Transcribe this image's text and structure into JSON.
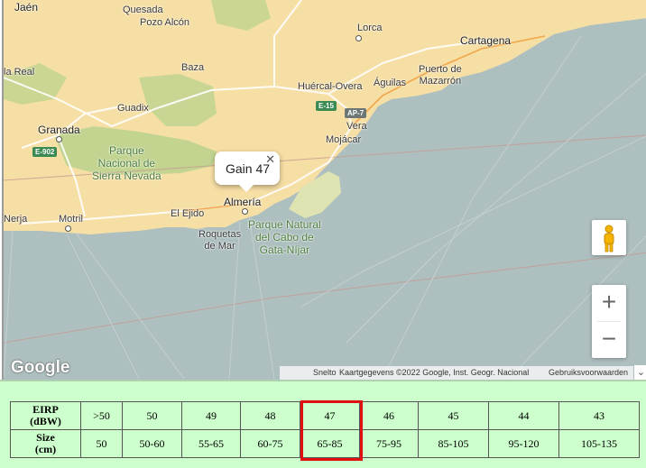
{
  "map": {
    "places": {
      "jaen": "Jaén",
      "quesada": "Quesada",
      "pozo_alcon": "Pozo Alcón",
      "lorca": "Lorca",
      "cartagena": "Cartagena",
      "la_real": "la Real",
      "baza": "Baza",
      "puerto_de_mazarron": "Puerto de\nMazarrón",
      "huercal_overa": "Huércal-Overa",
      "aguilas": "Águilas",
      "guadix": "Guadix",
      "vera": "Vera",
      "granada": "Granada",
      "mojacar": "Mojácar",
      "almeria": "Almería",
      "el_ejido": "El Ejido",
      "nerja": "Nerja",
      "motril": "Motril",
      "roquetas": "Roquetas\nde Mar",
      "park_sierra": "Parque\nNacional de\nSierra Nevada",
      "park_cabo": "Parque Natural\ndel Cabo de\nGata-Níjar"
    },
    "roads": {
      "e15": "E-15",
      "ap7": "AP-7",
      "e902": "E-902"
    },
    "popup": {
      "text": "Gain 47",
      "close": "✕"
    },
    "zoom_in": "+",
    "zoom_out": "−",
    "logo": "Google",
    "attribution": {
      "shortcuts": "Snelto",
      "data": "Kaartgegevens ©2022 Google, Inst. Geogr. Nacional",
      "terms": "Gebruiksvoorwaarden"
    },
    "chevron": "⌄",
    "icons": [
      "pegman-icon",
      "close-icon",
      "zoom-in-icon",
      "zoom-out-icon"
    ],
    "colors": {
      "land": "#f6dfa5",
      "sea": "#aebfc0",
      "park": "#b9d28c",
      "highlight": "#e01010",
      "table_bg": "#ccffcc"
    }
  },
  "table": {
    "eirp_header": "EIRP\n(dBW)",
    "size_header": "Size\n(cm)",
    "eirp": [
      ">50",
      "50",
      "49",
      "48",
      "47",
      "46",
      "45",
      "44",
      "43"
    ],
    "size": [
      "50",
      "50-60",
      "55-65",
      "60-75",
      "65-85",
      "75-95",
      "85-105",
      "95-120",
      "105-135"
    ],
    "highlighted_index": 4
  }
}
